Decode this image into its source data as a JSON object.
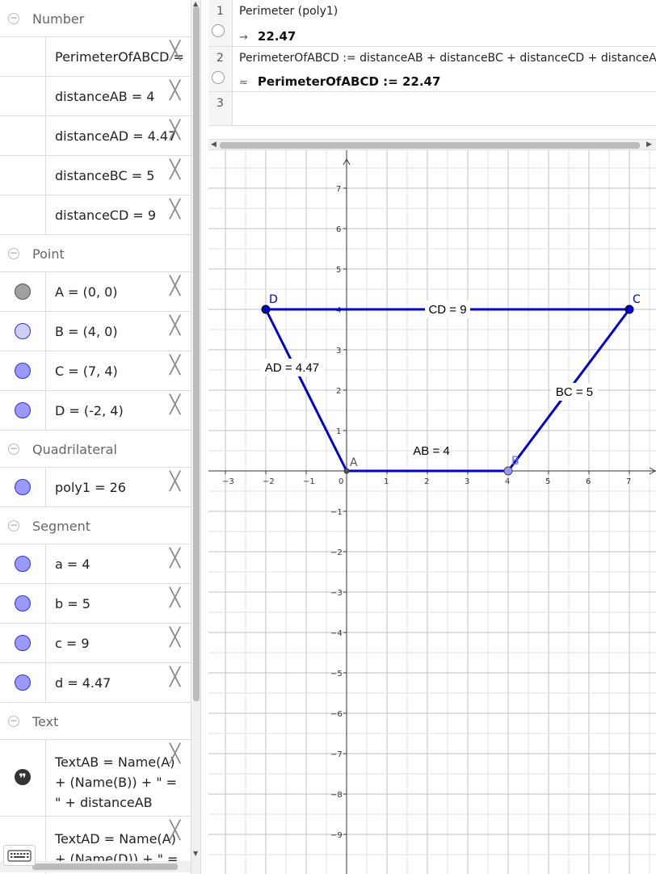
{
  "algebra": {
    "groups": [
      {
        "title": "Number",
        "items": [
          {
            "text": "PerimeterOfABCD =",
            "color": null
          },
          {
            "text": "distanceAB = 4",
            "color": null
          },
          {
            "text": "distanceAD = 4.47",
            "color": null
          },
          {
            "text": "distanceBC = 5",
            "color": null
          },
          {
            "text": "distanceCD = 9",
            "color": null
          }
        ]
      },
      {
        "title": "Point",
        "items": [
          {
            "text": "A = (0, 0)",
            "color": "#a0a0a0"
          },
          {
            "text": "B = (4, 0)",
            "color": "#cfcff5"
          },
          {
            "text": "C = (7, 4)",
            "color": "#9999ff"
          },
          {
            "text": "D = (-2, 4)",
            "color": "#9999ff"
          }
        ]
      },
      {
        "title": "Quadrilateral",
        "items": [
          {
            "text": "poly1 = 26",
            "color": "#9999ff"
          }
        ]
      },
      {
        "title": "Segment",
        "items": [
          {
            "text": "a = 4",
            "color": "#9999ff"
          },
          {
            "text": "b = 5",
            "color": "#9999ff"
          },
          {
            "text": "c = 9",
            "color": "#9999ff"
          },
          {
            "text": "d = 4.47",
            "color": "#9999ff"
          }
        ]
      },
      {
        "title": "Text",
        "items": [
          {
            "text": "TextAB = Name(A) + (Name(B)) + \" = \" + distanceAB"
          },
          {
            "text": "TextAD = Name(A) + (Name(D)) + \" ="
          }
        ]
      }
    ],
    "close_glyph": "╳",
    "toggle_glyph": "−",
    "quote_glyph": "❞"
  },
  "cas": {
    "rows": [
      {
        "num": "1",
        "input": "Perimeter (poly1)",
        "output_symbol": "→",
        "output": "22.47"
      },
      {
        "num": "2",
        "input": "PerimeterOfABCD := distanceAB + distanceBC + distanceCD + distanceAD",
        "output_symbol": "≈",
        "output": "PerimeterOfABCD := 22.47"
      },
      {
        "num": "3",
        "input": "",
        "output_symbol": "",
        "output": ""
      }
    ]
  },
  "graphics": {
    "x_ticks": [
      "−3",
      "−2",
      "−1",
      "0",
      "1",
      "2",
      "3",
      "4",
      "5",
      "6",
      "7"
    ],
    "y_ticks_pos": [
      "1",
      "2",
      "3",
      "4",
      "5",
      "6",
      "7"
    ],
    "y_ticks_neg": [
      "−1",
      "−2",
      "−3",
      "−4",
      "−5",
      "−6",
      "−7",
      "−8",
      "−9"
    ],
    "points": [
      {
        "name": "A",
        "x": 0,
        "y": 0,
        "color": "#555555"
      },
      {
        "name": "B",
        "x": 4,
        "y": 0,
        "color": "#6666ff"
      },
      {
        "name": "C",
        "x": 7,
        "y": 4,
        "color": "#0000cc"
      },
      {
        "name": "D",
        "x": -2,
        "y": 4,
        "color": "#0000cc"
      }
    ],
    "segment_color": "#0000cc",
    "labels": {
      "ab": "AB = 4",
      "bc": "BC = 5",
      "cd": "CD = 9",
      "ad": "AD = 4.47"
    }
  }
}
